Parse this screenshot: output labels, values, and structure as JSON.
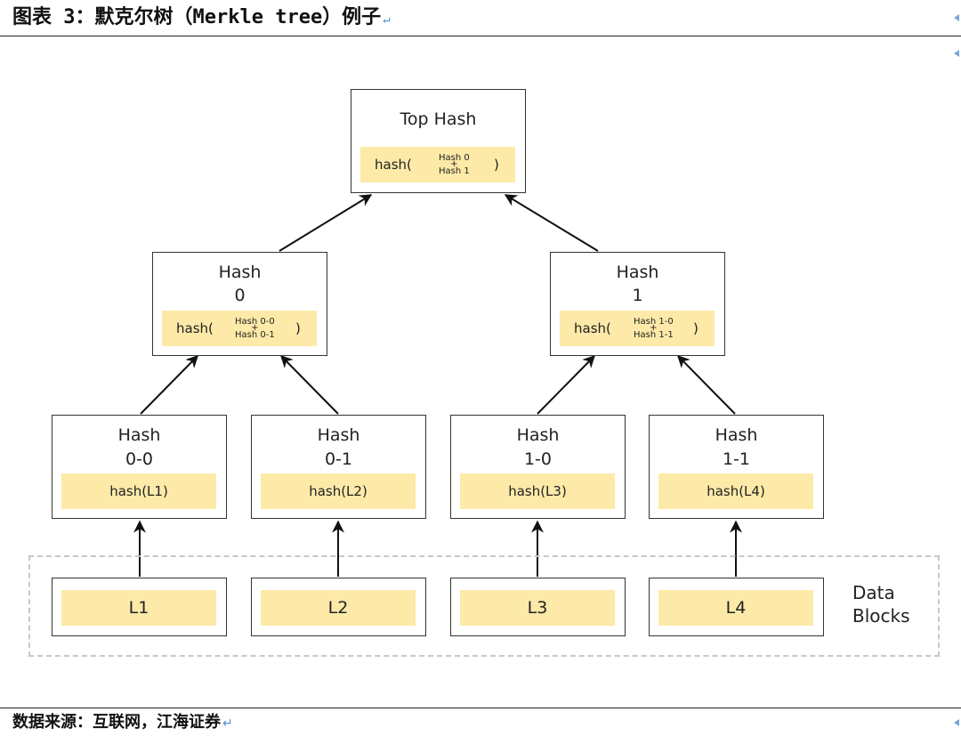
{
  "header": {
    "caption": "图表 3：默克尔树（Merkle tree）例子"
  },
  "footer": {
    "source": "数据来源：互联网，江海证券"
  },
  "tree": {
    "top": {
      "title": "Top Hash",
      "fn": "hash(",
      "a": "Hash 0",
      "plus": "+",
      "b": "Hash 1",
      "close": ")"
    },
    "h0": {
      "title_1": "Hash",
      "title_2": "0",
      "fn": "hash(",
      "a": "Hash 0-0",
      "plus": "+",
      "b": "Hash 0-1",
      "close": ")"
    },
    "h1": {
      "title_1": "Hash",
      "title_2": "1",
      "fn": "hash(",
      "a": "Hash 1-0",
      "plus": "+",
      "b": "Hash 1-1",
      "close": ")"
    },
    "leaves": [
      {
        "title_1": "Hash",
        "title_2": "0-0",
        "hash": "hash(L1)",
        "block": "L1"
      },
      {
        "title_1": "Hash",
        "title_2": "0-1",
        "hash": "hash(L2)",
        "block": "L2"
      },
      {
        "title_1": "Hash",
        "title_2": "1-0",
        "hash": "hash(L3)",
        "block": "L3"
      },
      {
        "title_1": "Hash",
        "title_2": "1-1",
        "hash": "hash(L4)",
        "block": "L4"
      }
    ],
    "data_blocks_label_1": "Data",
    "data_blocks_label_2": "Blocks"
  },
  "colors": {
    "hash_fill": "#fdeaa8",
    "box_border": "#333333",
    "dashed_border": "#c8c8c8"
  }
}
